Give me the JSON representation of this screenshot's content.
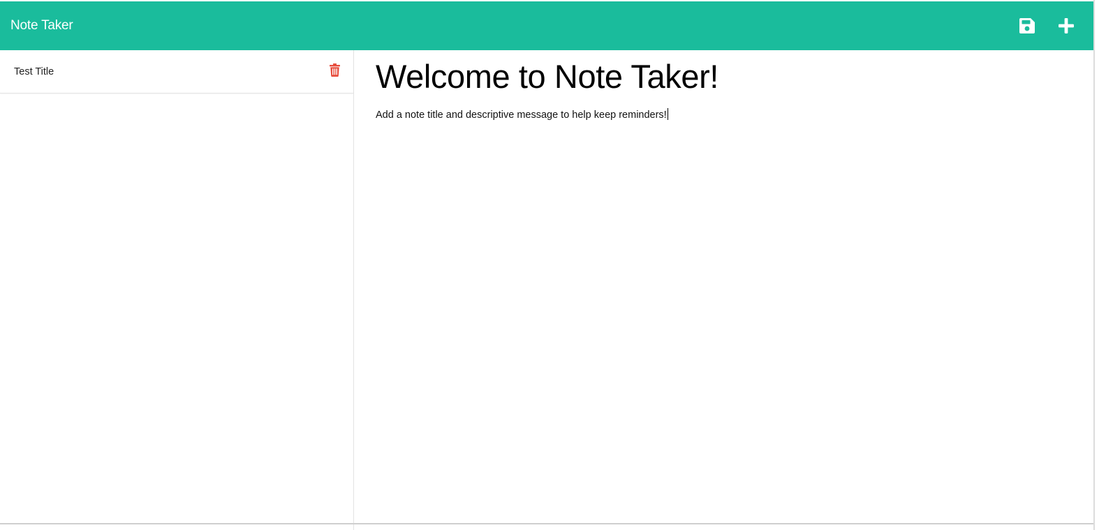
{
  "app": {
    "brand": "Note Taker",
    "accent_color": "#1abc9c",
    "delete_color": "#e74c3c"
  },
  "toolbar": {
    "save_icon": "floppy-disk-icon",
    "new_icon": "plus-icon"
  },
  "notes_list": {
    "items": [
      {
        "title": "Test Title",
        "delete_icon": "trash-icon"
      }
    ]
  },
  "editor": {
    "title": "Welcome to Note Taker!",
    "text": "Add a note title and descriptive message to help keep reminders!"
  }
}
